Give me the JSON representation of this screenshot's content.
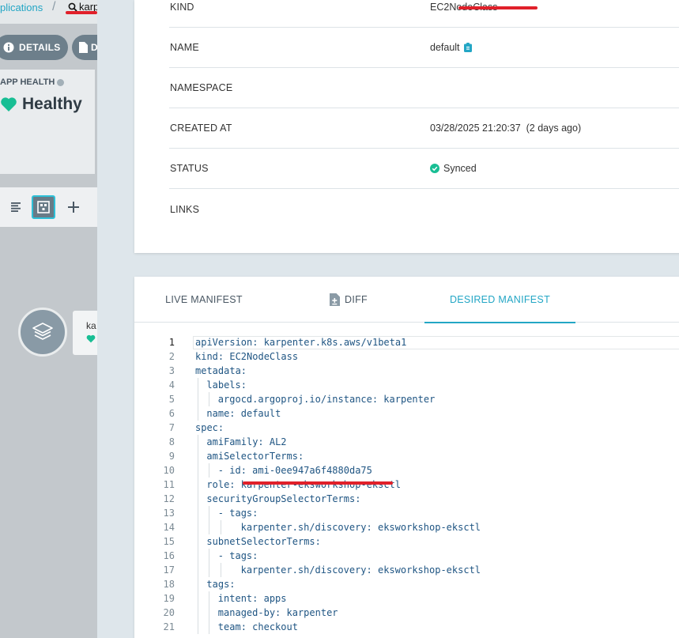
{
  "breadcrumb": {
    "applications": "plications",
    "search": "karp"
  },
  "left_panel": {
    "details_button": "DETAILS",
    "second_button": "D",
    "app_health_title": "APP HEALTH",
    "app_health_value": "Healthy",
    "node_name": "ka"
  },
  "summary": {
    "rows": [
      {
        "key": "KIND",
        "value": "EC2NodeClass"
      },
      {
        "key": "NAME",
        "value": "default"
      },
      {
        "key": "NAMESPACE",
        "value": ""
      },
      {
        "key": "CREATED AT",
        "value": "03/28/2025 21:20:37  (2 days ago)"
      },
      {
        "key": "STATUS",
        "value": "Synced"
      },
      {
        "key": "LINKS",
        "value": ""
      }
    ]
  },
  "tabs": {
    "live": "LIVE MANIFEST",
    "diff": "DIFF",
    "desired": "DESIRED MANIFEST"
  },
  "manifest": {
    "lines": [
      {
        "n": "1",
        "indent": 0,
        "text": "apiVersion: karpenter.k8s.aws/v1beta1"
      },
      {
        "n": "2",
        "indent": 0,
        "text": "kind: EC2NodeClass"
      },
      {
        "n": "3",
        "indent": 0,
        "text": "metadata:"
      },
      {
        "n": "4",
        "indent": 1,
        "text": "labels:"
      },
      {
        "n": "5",
        "indent": 2,
        "text": "argocd.argoproj.io/instance: karpenter"
      },
      {
        "n": "6",
        "indent": 1,
        "text": "name: default"
      },
      {
        "n": "7",
        "indent": 0,
        "text": "spec:"
      },
      {
        "n": "8",
        "indent": 1,
        "text": "amiFamily: AL2"
      },
      {
        "n": "9",
        "indent": 1,
        "text": "amiSelectorTerms:"
      },
      {
        "n": "10",
        "indent": 2,
        "text": "- id: ami-0ee947a6f4880da75"
      },
      {
        "n": "11",
        "indent": 1,
        "text": "role: karpenter-eksworkshop-eksctl"
      },
      {
        "n": "12",
        "indent": 1,
        "text": "securityGroupSelectorTerms:"
      },
      {
        "n": "13",
        "indent": 2,
        "text": "- tags:"
      },
      {
        "n": "14",
        "indent": 4,
        "text": "karpenter.sh/discovery: eksworkshop-eksctl"
      },
      {
        "n": "15",
        "indent": 1,
        "text": "subnetSelectorTerms:"
      },
      {
        "n": "16",
        "indent": 2,
        "text": "- tags:"
      },
      {
        "n": "17",
        "indent": 4,
        "text": "karpenter.sh/discovery: eksworkshop-eksctl"
      },
      {
        "n": "18",
        "indent": 1,
        "text": "tags:"
      },
      {
        "n": "19",
        "indent": 2,
        "text": "intent: apps"
      },
      {
        "n": "20",
        "indent": 2,
        "text": "managed-by: karpenter"
      },
      {
        "n": "21",
        "indent": 2,
        "text": "team: checkout"
      }
    ]
  },
  "colors": {
    "accent": "#23a6c5",
    "healthy": "#18be94",
    "highlight": "#e0202a"
  }
}
